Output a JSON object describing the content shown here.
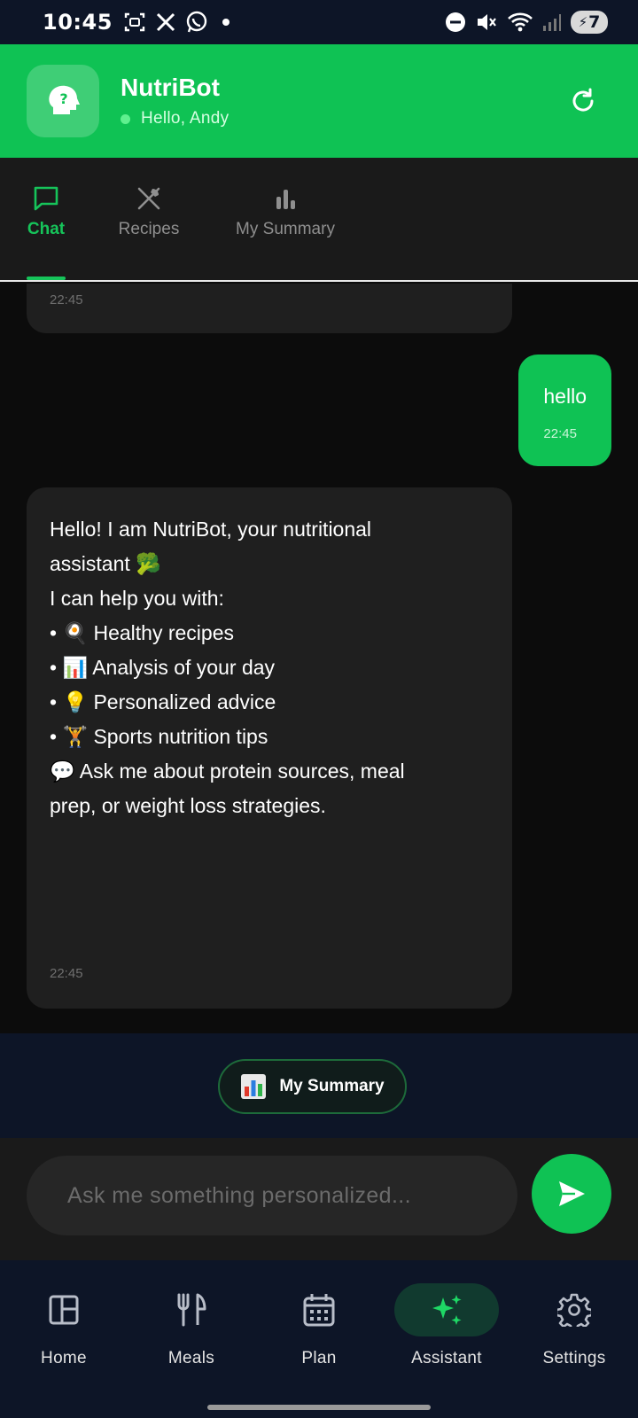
{
  "status_bar": {
    "time": "10:45",
    "battery": "7",
    "left_icons": [
      "screenshot-icon",
      "x-icon",
      "whatsapp-icon",
      "dot-icon"
    ],
    "right_icons": [
      "do-not-disturb-icon",
      "mute-icon",
      "wifi-icon",
      "signal-icon"
    ]
  },
  "header": {
    "title": "NutriBot",
    "greeting": "Hello, Andy",
    "logo_icon": "brain-head-icon",
    "refresh_icon": "refresh-icon"
  },
  "tabs": [
    {
      "label": "Chat",
      "icon": "chat-icon",
      "active": true
    },
    {
      "label": "Recipes",
      "icon": "utensils-crossed-icon",
      "active": false
    },
    {
      "label": "My Summary",
      "icon": "bar-chart-icon",
      "active": false
    }
  ],
  "chat": {
    "messages": [
      {
        "from": "bot",
        "time": "22:45",
        "partial": true
      },
      {
        "from": "user",
        "text": "hello",
        "time": "22:45"
      },
      {
        "from": "bot",
        "time": "22:45",
        "lines": [
          "Hello! I am NutriBot, your nutritional",
          "assistant 🥦",
          "",
          "I can help you with:",
          "• 🍳 Healthy recipes",
          "• 📊 Analysis of your day",
          "• 💡 Personalized advice",
          "• 🏋 Sports nutrition tips",
          "",
          "💬 Ask me about protein sources, meal",
          "prep, or weight loss strategies."
        ]
      }
    ]
  },
  "quick_action": {
    "label": "My Summary",
    "icon": "bar-chart-emoji-icon"
  },
  "input": {
    "placeholder": "Ask me something personalized...",
    "value": ""
  },
  "send_icon": "send-icon",
  "bottom_nav": [
    {
      "label": "Home",
      "icon": "layout-icon",
      "active": false
    },
    {
      "label": "Meals",
      "icon": "fork-knife-icon",
      "active": false
    },
    {
      "label": "Plan",
      "icon": "calendar-icon",
      "active": false
    },
    {
      "label": "Assistant",
      "icon": "sparkles-icon",
      "active": true
    },
    {
      "label": "Settings",
      "icon": "gear-icon",
      "active": false
    }
  ],
  "colors": {
    "brand_green": "#0fc254",
    "navy": "#0d1527",
    "chat_bg": "#0c0c0c",
    "bot_bubble": "#1f1f1f"
  }
}
